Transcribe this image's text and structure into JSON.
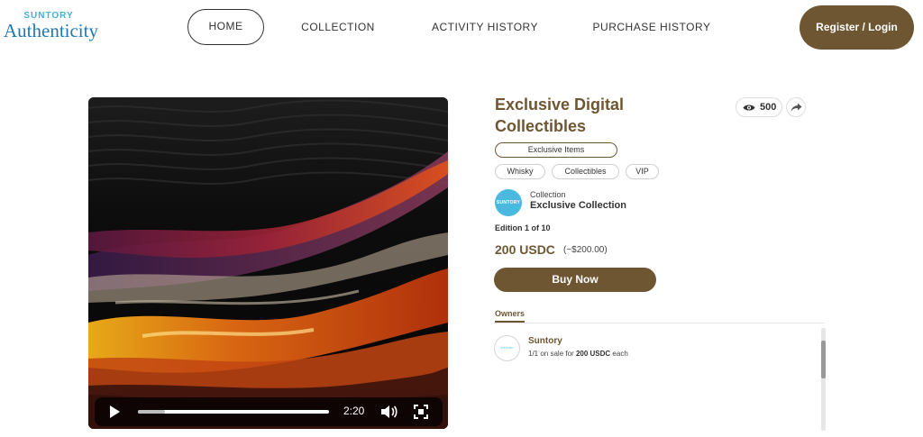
{
  "header": {
    "logo_top": "SUNTORY",
    "logo_main": "Authenticity",
    "nav": [
      "HOME",
      "COLLECTION",
      "ACTIVITY HISTORY",
      "PURCHASE HISTORY"
    ],
    "login_label": "Register / Login"
  },
  "media": {
    "time": "2:20",
    "progress": 0.14,
    "icons": [
      "play-icon",
      "volume-icon",
      "fullscreen-icon"
    ]
  },
  "item": {
    "title": "Exclusive Digital Collectibles",
    "views": "500",
    "category": "Exclusive Items",
    "tags": [
      "Whisky",
      "Collectibles",
      "VIP"
    ],
    "collection_label": "Collection",
    "collection_name": "Exclusive Collection",
    "collection_avatar_text": "SUNTORY",
    "edition": "Edition 1 of 10",
    "price": "200 USDC",
    "price_fiat": "(~$200.00)",
    "buy_label": "Buy Now"
  },
  "owners": {
    "tab_label": "Owners",
    "entries": [
      {
        "name": "Suntory",
        "sale_prefix": "1/1 on sale for",
        "sale_price": "200 USDC",
        "sale_suffix": "each"
      }
    ]
  },
  "colors": {
    "brand_brown": "#6f5632",
    "logo_blue": "#1f78b4",
    "logo_cyan": "#3fb2d8"
  }
}
